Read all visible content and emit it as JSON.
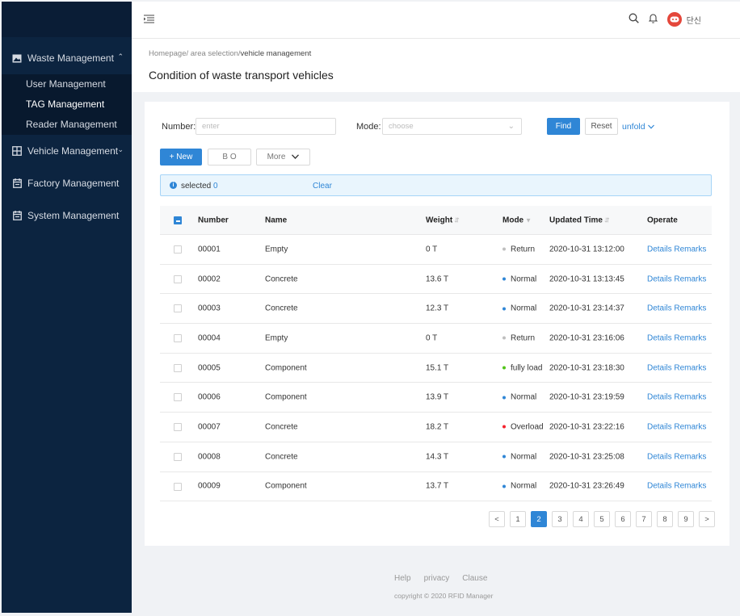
{
  "sidebar": {
    "groups": [
      {
        "label": "Waste Management",
        "icon": "image-icon",
        "expanded": true
      },
      {
        "label": "Vehicle Management",
        "icon": "grid-icon",
        "expanded": false
      },
      {
        "label": "Factory Management",
        "icon": "calendar-icon"
      },
      {
        "label": "System Management",
        "icon": "calendar-icon"
      }
    ],
    "sub_items": [
      "User Management",
      "TAG Management",
      "Reader Management"
    ]
  },
  "header": {
    "username": "단신",
    "icons": [
      "menu-fold-icon",
      "search-icon",
      "bell-icon",
      "avatar"
    ]
  },
  "breadcrumb": {
    "prefix": "Homepage/ area selection/",
    "current": "vehicle management"
  },
  "page_title": "Condition of waste transport vehicles",
  "filters": {
    "number_label": "Number:",
    "number_placeholder": "enter",
    "mode_label": "Mode:",
    "mode_placeholder": "choose",
    "find_label": "Find",
    "reset_label": "Reset",
    "unfold_label": "unfold"
  },
  "toolbar": {
    "new_label": "+ New",
    "bo_label": "B O",
    "more_label": "More"
  },
  "alert": {
    "selected_label": "selected",
    "selected_count": "0",
    "clear_label": "Clear"
  },
  "table": {
    "headers": {
      "number": "Number",
      "name": "Name",
      "weight": "Weight",
      "mode": "Mode",
      "updated": "Updated Time",
      "operate": "Operate"
    },
    "rows": [
      {
        "number": "00001",
        "name": "Empty",
        "weight": "0 T",
        "mode": "Return",
        "mode_color": "#bfbfbf",
        "updated": "2020-10-31  13:12:00",
        "details": "Details",
        "remarks": "Remarks"
      },
      {
        "number": "00002",
        "name": "Concrete",
        "weight": "13.6 T",
        "mode": "Normal",
        "mode_color": "#2f86d6",
        "updated": "2020-10-31  13:13:45",
        "details": "Details",
        "remarks": "Remarks"
      },
      {
        "number": "00003",
        "name": "Concrete",
        "weight": "12.3 T",
        "mode": "Normal",
        "mode_color": "#2f86d6",
        "updated": "2020-10-31  23:14:37",
        "details": "Details",
        "remarks": "Remarks"
      },
      {
        "number": "00004",
        "name": "Empty",
        "weight": "0 T",
        "mode": "Return",
        "mode_color": "#bfbfbf",
        "updated": "2020-10-31  23:16:06",
        "details": "Details",
        "remarks": "Remarks"
      },
      {
        "number": "00005",
        "name": "Component",
        "weight": "15.1 T",
        "mode": "fully load",
        "mode_color": "#52c41a",
        "updated": "2020-10-31  23:18:30",
        "details": "Details",
        "remarks": "Remarks"
      },
      {
        "number": "00006",
        "name": "Component",
        "weight": "13.9 T",
        "mode": "Normal",
        "mode_color": "#2f86d6",
        "updated": "2020-10-31  23:19:59",
        "details": "Details",
        "remarks": "Remarks"
      },
      {
        "number": "00007",
        "name": "Concrete",
        "weight": "18.2 T",
        "mode": "Overload",
        "mode_color": "#f5222d",
        "updated": "2020-10-31  23:22:16",
        "details": "Details",
        "remarks": "Remarks"
      },
      {
        "number": "00008",
        "name": "Concrete",
        "weight": "14.3 T",
        "mode": "Normal",
        "mode_color": "#2f86d6",
        "updated": "2020-10-31  23:25:08",
        "details": "Details",
        "remarks": "Remarks"
      },
      {
        "number": "00009",
        "name": "Component",
        "weight": "13.7 T",
        "mode": "Normal",
        "mode_color": "#2f86d6",
        "updated": "2020-10-31  23:26:49",
        "details": "Details",
        "remarks": "Remarks"
      }
    ]
  },
  "pagination": {
    "prev": "<",
    "next": ">",
    "pages": [
      "1",
      "2",
      "3",
      "4",
      "5",
      "6",
      "7",
      "8",
      "9"
    ],
    "current": "2"
  },
  "footer": {
    "links": [
      "Help",
      "privacy",
      "Clause"
    ],
    "copyright": "copyright © 2020 RFID Manager"
  },
  "colors": {
    "sidebar_bg": "#0c2440",
    "primary": "#2f86d6"
  }
}
